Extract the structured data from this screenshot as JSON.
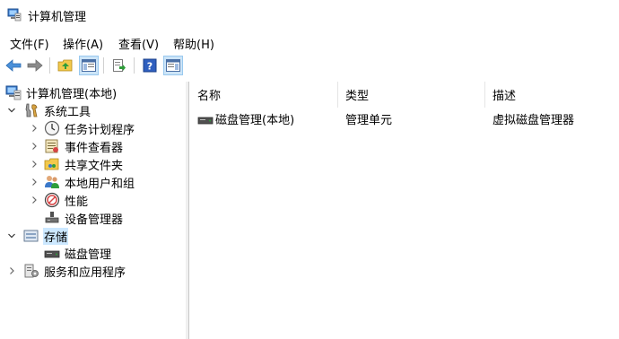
{
  "window": {
    "title": "计算机管理"
  },
  "menubar": {
    "items": [
      "文件(F)",
      "操作(A)",
      "查看(V)",
      "帮助(H)"
    ]
  },
  "toolbar": {
    "buttons": [
      "back-arrow-icon",
      "forward-arrow-icon",
      "up-folder-icon",
      "show-hide-tree-icon",
      "export-list-icon",
      "help-icon",
      "show-action-pane-icon"
    ]
  },
  "tree": {
    "root": "计算机管理(本地)",
    "system_tools": "系统工具",
    "task_scheduler": "任务计划程序",
    "event_viewer": "事件查看器",
    "shared_folders": "共享文件夹",
    "local_users": "本地用户和组",
    "performance": "性能",
    "device_manager": "设备管理器",
    "storage": "存储",
    "disk_management": "磁盘管理",
    "services_apps": "服务和应用程序"
  },
  "list": {
    "headers": {
      "name": "名称",
      "type": "类型",
      "description": "描述"
    },
    "rows": [
      {
        "name": "磁盘管理(本地)",
        "type": "管理单元",
        "description": "虚拟磁盘管理器"
      }
    ]
  },
  "colors": {
    "selection": "#cce8ff",
    "accent": "#0078d7"
  }
}
